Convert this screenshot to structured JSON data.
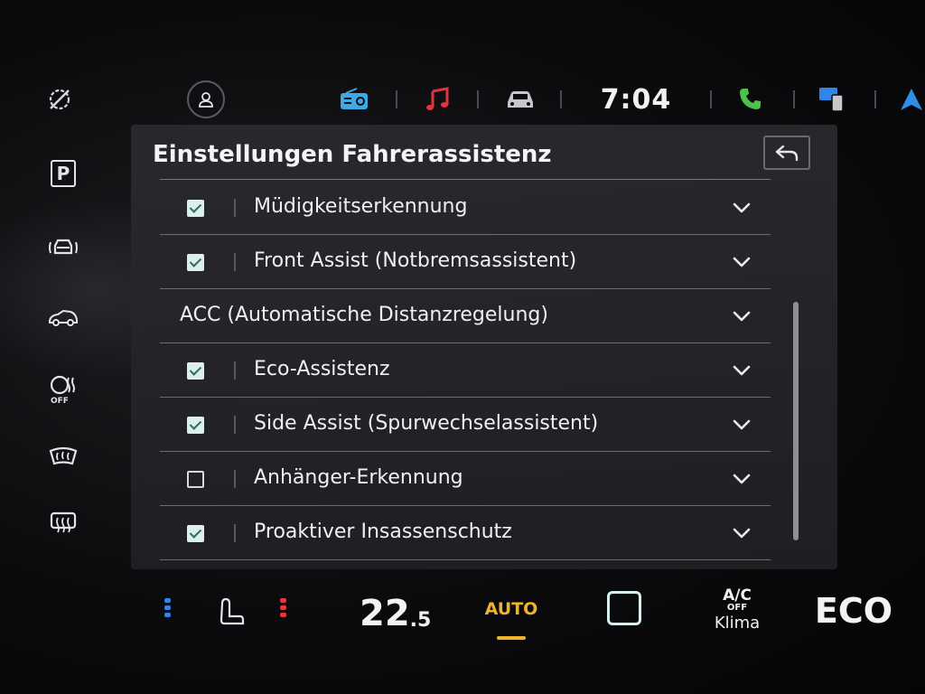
{
  "topbar": {
    "time": "7:04",
    "icons": [
      "assist-off-icon",
      "profile-icon",
      "radio-icon",
      "music-icon",
      "car-icon",
      "phone-icon",
      "app-connect-icon",
      "navigation-icon"
    ]
  },
  "leftcol": {
    "icons": [
      "assist-off-icon",
      "parking-icon",
      "lane-assist-icon",
      "car-view-icon",
      "heated-wheel-off-icon",
      "front-defrost-icon",
      "rear-defrost-icon"
    ],
    "parking_label": "P"
  },
  "panel": {
    "title": "Einstellungen Fahrerassistenz",
    "rows": [
      {
        "label": "Müdigkeitserkennung",
        "checked": true,
        "header": false
      },
      {
        "label": "Front Assist (Notbremsassistent)",
        "checked": true,
        "header": false
      },
      {
        "label": "ACC (Automatische Distanzregelung)",
        "checked": null,
        "header": true
      },
      {
        "label": "Eco-Assistenz",
        "checked": true,
        "header": false
      },
      {
        "label": "Side Assist (Spurwechselassistent)",
        "checked": true,
        "header": false
      },
      {
        "label": "Anhänger-Erkennung",
        "checked": false,
        "header": false
      },
      {
        "label": "Proaktiver Insassenschutz",
        "checked": true,
        "header": false
      }
    ]
  },
  "bottombar": {
    "temp_whole": "22",
    "temp_decimal": ".5",
    "auto_label": "AUTO",
    "ac_label": "A/C",
    "ac_off_label": "OFF",
    "klima_label": "Klima",
    "eco_label": "ECO"
  },
  "colors": {
    "accent_auto": "#f0b428",
    "checkbox_on": "#dcefed",
    "radio_blue": "#3fa8e6",
    "music_red": "#e2343f",
    "phone_green": "#4cc24a",
    "nav_blue": "#2f8fe6",
    "seat_cool_blue": "#2f86e8",
    "seat_heat_red": "#e23a3a"
  }
}
